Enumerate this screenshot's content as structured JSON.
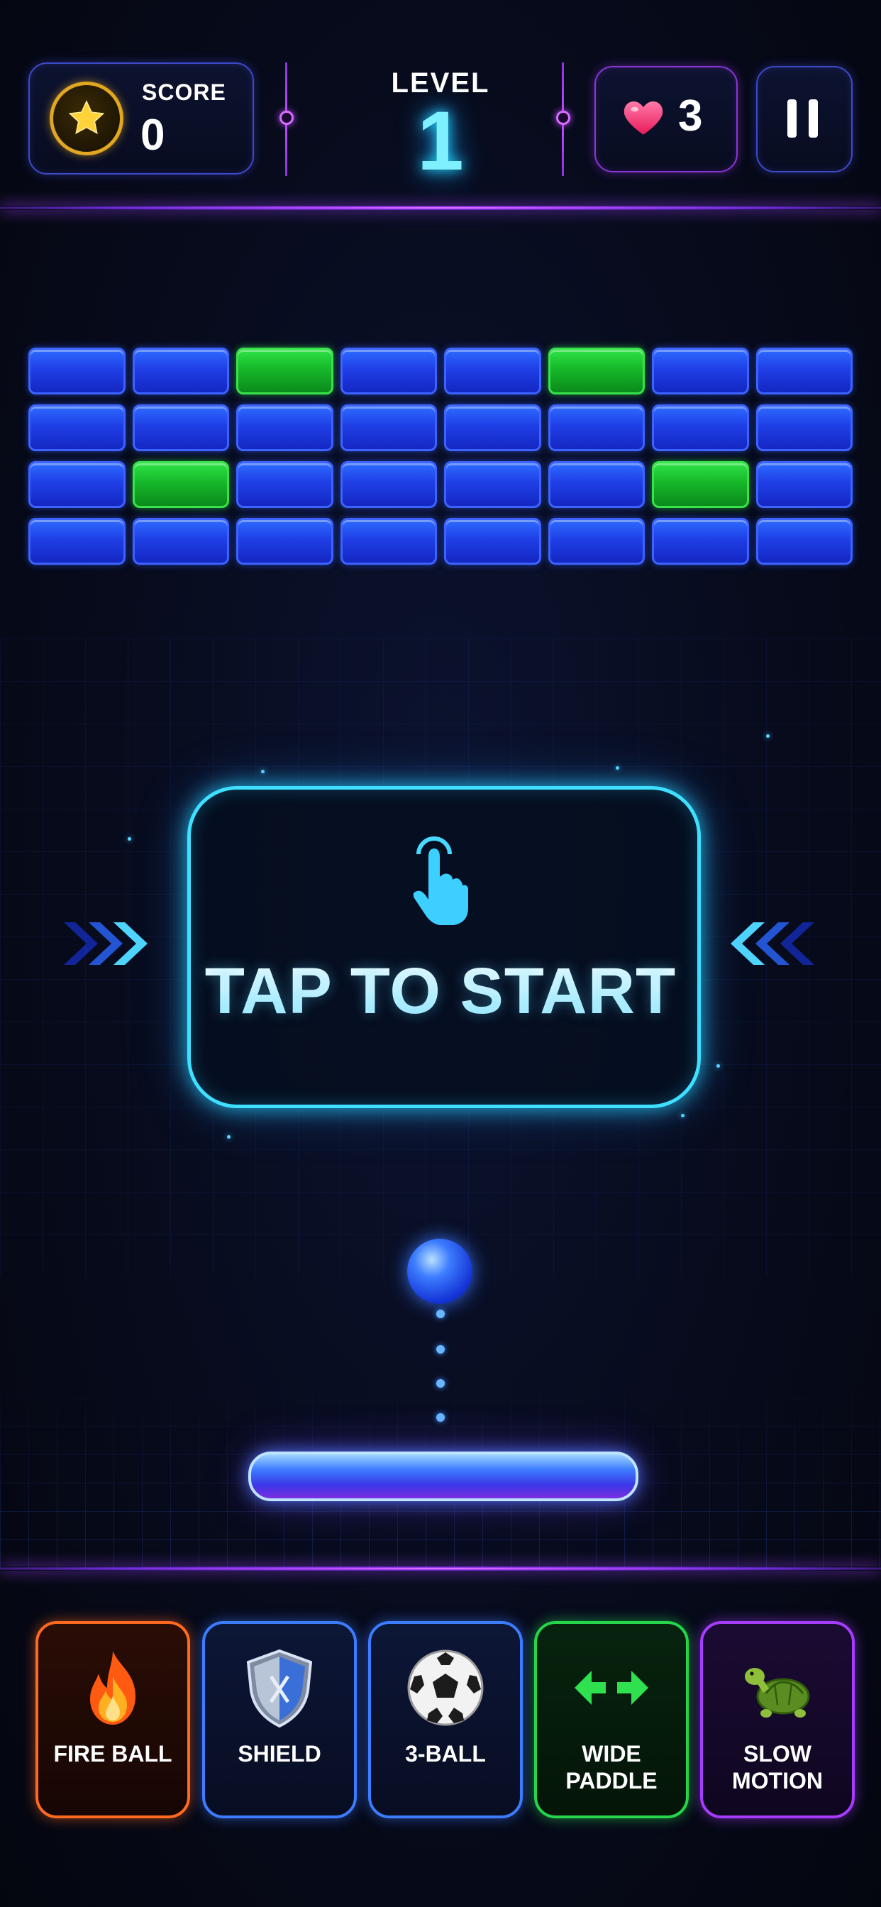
{
  "hud": {
    "score_label": "SCORE",
    "score_value": "0",
    "level_label": "LEVEL",
    "level_value": "1",
    "lives_value": "3",
    "icons": [
      "star-icon",
      "heart-icon",
      "pause-icon"
    ]
  },
  "bricks": {
    "rows": [
      [
        "blue",
        "blue",
        "green",
        "blue",
        "blue",
        "green",
        "blue",
        "blue"
      ],
      [
        "blue",
        "blue",
        "blue",
        "blue",
        "blue",
        "blue",
        "blue",
        "blue"
      ],
      [
        "blue",
        "green",
        "blue",
        "blue",
        "blue",
        "blue",
        "green",
        "blue"
      ],
      [
        "blue",
        "blue",
        "blue",
        "blue",
        "blue",
        "blue",
        "blue",
        "blue"
      ]
    ],
    "colors": {
      "blue": "#1f3fe6",
      "green": "#16b82a"
    }
  },
  "start": {
    "label": "TAP TO START",
    "icon": "tap-hand-icon"
  },
  "powerups": [
    {
      "label": "FIRE BALL",
      "icon": "fireball-icon",
      "color": "#ff6a1e"
    },
    {
      "label": "SHIELD",
      "icon": "shield-icon",
      "color": "#3c7cff"
    },
    {
      "label": "3-BALL",
      "icon": "soccer-ball-icon",
      "color": "#3c7cff"
    },
    {
      "label": "WIDE\nPADDLE",
      "icon": "wide-arrows-icon",
      "color": "#25d54a"
    },
    {
      "label": "SLOW\nMOTION",
      "icon": "turtle-icon",
      "color": "#a53cff"
    }
  ],
  "theme": {
    "accent_cyan": "#3fe0ff",
    "accent_purple": "#c04cff"
  }
}
